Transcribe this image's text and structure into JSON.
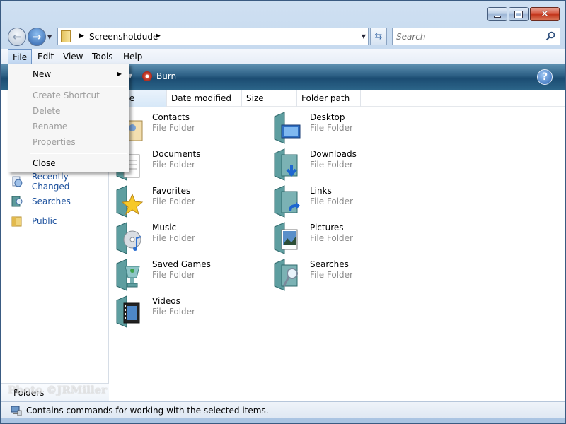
{
  "window": {
    "minimize_label": "Minimize",
    "maximize_label": "Maximize",
    "close_label": "Close"
  },
  "address": {
    "location": "Screenshotdude"
  },
  "search": {
    "placeholder": "Search"
  },
  "menubar": {
    "items": [
      "File",
      "Edit",
      "View",
      "Tools",
      "Help"
    ],
    "active": "File"
  },
  "commandbar": {
    "burn_label": "Burn",
    "help_label": "?"
  },
  "file_menu": {
    "items": [
      {
        "label": "New",
        "enabled": true,
        "submenu": true
      },
      {
        "label": "Create Shortcut",
        "enabled": false
      },
      {
        "label": "Delete",
        "enabled": false
      },
      {
        "label": "Rename",
        "enabled": false
      },
      {
        "label": "Properties",
        "enabled": false
      },
      {
        "label": "Close",
        "enabled": true
      }
    ]
  },
  "navpane": {
    "links": [
      {
        "label": "Recently Changed",
        "icon": "recently-changed-icon"
      },
      {
        "label": "Searches",
        "icon": "searches-icon"
      },
      {
        "label": "Public",
        "icon": "public-folder-icon"
      }
    ],
    "folders_label": "Folders"
  },
  "columns": [
    "me",
    "Date modified",
    "Size",
    "Folder path"
  ],
  "folders": [
    {
      "name": "Contacts",
      "type": "File Folder",
      "icon": "contacts-folder-icon"
    },
    {
      "name": "Desktop",
      "type": "File Folder",
      "icon": "desktop-folder-icon"
    },
    {
      "name": "Documents",
      "type": "File Folder",
      "icon": "documents-folder-icon"
    },
    {
      "name": "Downloads",
      "type": "File Folder",
      "icon": "downloads-folder-icon"
    },
    {
      "name": "Favorites",
      "type": "File Folder",
      "icon": "favorites-folder-icon"
    },
    {
      "name": "Links",
      "type": "File Folder",
      "icon": "links-folder-icon"
    },
    {
      "name": "Music",
      "type": "File Folder",
      "icon": "music-folder-icon"
    },
    {
      "name": "Pictures",
      "type": "File Folder",
      "icon": "pictures-folder-icon"
    },
    {
      "name": "Saved Games",
      "type": "File Folder",
      "icon": "saved-games-folder-icon"
    },
    {
      "name": "Searches",
      "type": "File Folder",
      "icon": "searches-folder-icon"
    },
    {
      "name": "Videos",
      "type": "File Folder",
      "icon": "videos-folder-icon"
    }
  ],
  "statusbar": {
    "text": "Contains commands for working with the selected items."
  },
  "watermark": {
    "text": "Photo ©JRMiller"
  },
  "colors": {
    "command_bar": "#1b4c72",
    "link": "#1a4f9c",
    "disabled_text": "#9d9d9d",
    "folder_type_text": "#8c8c8c"
  }
}
